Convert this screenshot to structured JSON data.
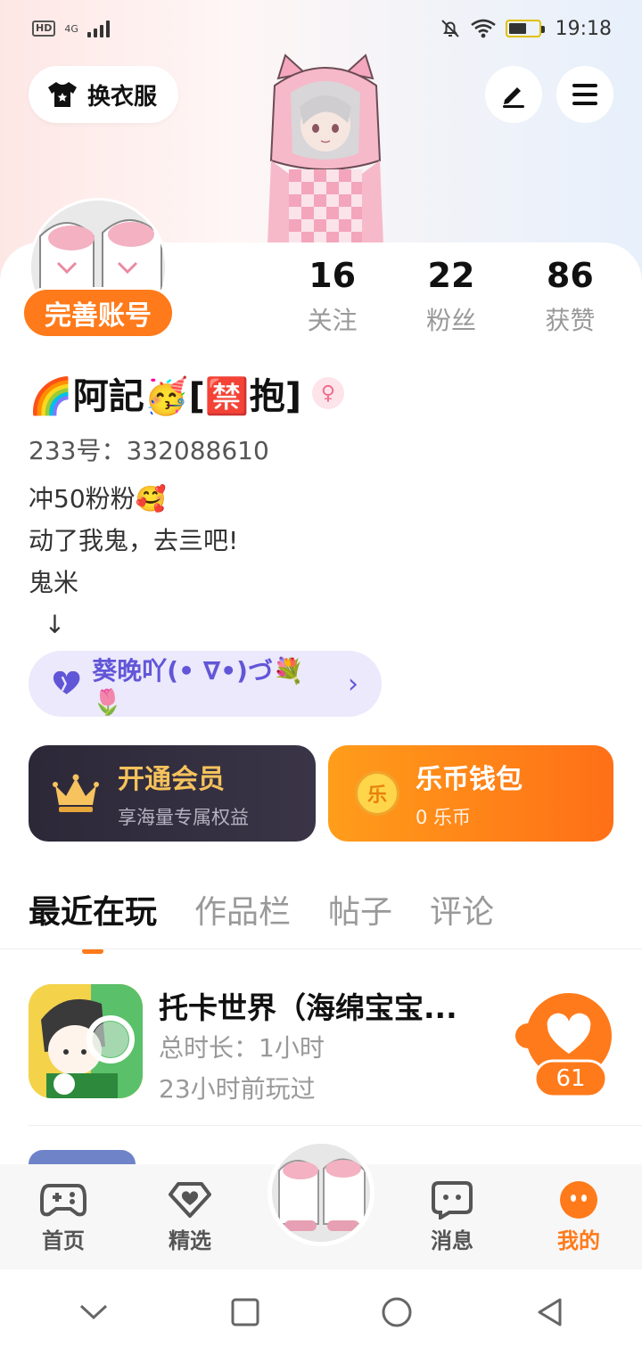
{
  "status_bar": {
    "hd": "HD",
    "network": "4G",
    "time": "19:18"
  },
  "header": {
    "dress_label": "换衣服",
    "edit_icon": "pen-icon",
    "menu_icon": "menu-icon"
  },
  "profile": {
    "perfect_account_label": "完善账号",
    "stats": [
      {
        "value": "16",
        "label": "关注"
      },
      {
        "value": "22",
        "label": "粉丝"
      },
      {
        "value": "86",
        "label": "获赞"
      }
    ],
    "nickname": "🌈阿記🥳[🈲抱]",
    "gender_symbol": "♀",
    "uid": "233号：332088610",
    "bio_lines": [
      "冲50粉粉🥰",
      "动了我鬼，去亖吧!",
      "鬼米",
      "  ↓"
    ],
    "guard": {
      "text": "葵晚吖(• ∇•)づ💐🌷",
      "arrow": "›"
    }
  },
  "features": {
    "vip": {
      "title": "开通会员",
      "subtitle": "享海量专属权益"
    },
    "wallet": {
      "title": "乐币钱包",
      "subtitle": "0 乐币",
      "coin_char": "乐"
    }
  },
  "tabs": [
    {
      "label": "最近在玩",
      "active": true
    },
    {
      "label": "作品栏",
      "active": false
    },
    {
      "label": "帖子",
      "active": false
    },
    {
      "label": "评论",
      "active": false
    }
  ],
  "games": [
    {
      "title": "托卡世界（海绵宝宝...",
      "duration": "总时长：1小时",
      "last_played": "23小时前玩过",
      "likes": "61"
    }
  ],
  "bottom_nav": [
    {
      "label": "首页",
      "icon": "gamepad-icon",
      "active": false
    },
    {
      "label": "精选",
      "icon": "heart-diamond-icon",
      "active": false
    },
    {
      "label": "消息",
      "icon": "chat-icon",
      "active": false
    },
    {
      "label": "我的",
      "icon": "face-icon",
      "active": true
    }
  ],
  "colors": {
    "accent": "#ff7a1a",
    "guard_purple": "#6256d8",
    "vip_gold": "#f5c25c"
  }
}
